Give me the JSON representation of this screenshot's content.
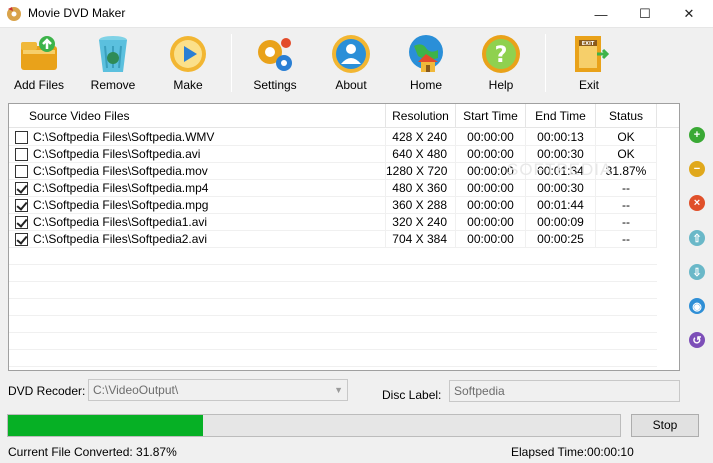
{
  "window": {
    "title": "Movie DVD Maker",
    "minimize": "—",
    "maximize": "☐",
    "close": "✕"
  },
  "toolbar": {
    "add_files": "Add Files",
    "remove": "Remove",
    "make": "Make",
    "settings": "Settings",
    "about": "About",
    "home": "Home",
    "help": "Help",
    "exit": "Exit",
    "exit_badge": "EXIT"
  },
  "list": {
    "headers": [
      "Source Video Files",
      "Resolution",
      "Start Time",
      "End Time",
      "Status"
    ],
    "rows": [
      {
        "checked": false,
        "file": "C:\\Softpedia Files\\Softpedia.WMV",
        "resolution": "428 X 240",
        "start": "00:00:00",
        "end": "00:00:13",
        "status": "OK"
      },
      {
        "checked": false,
        "file": "C:\\Softpedia Files\\Softpedia.avi",
        "resolution": "640 X 480",
        "start": "00:00:00",
        "end": "00:00:30",
        "status": "OK"
      },
      {
        "checked": false,
        "file": "C:\\Softpedia Files\\Softpedia.mov",
        "resolution": "1280 X 720",
        "start": "00:00:00",
        "end": "00:01:34",
        "status": "31.87%"
      },
      {
        "checked": true,
        "file": "C:\\Softpedia Files\\Softpedia.mp4",
        "resolution": "480 X 360",
        "start": "00:00:00",
        "end": "00:00:30",
        "status": "--"
      },
      {
        "checked": true,
        "file": "C:\\Softpedia Files\\Softpedia.mpg",
        "resolution": "360 X 288",
        "start": "00:00:00",
        "end": "00:01:44",
        "status": "--"
      },
      {
        "checked": true,
        "file": "C:\\Softpedia Files\\Softpedia1.avi",
        "resolution": "320 X 240",
        "start": "00:00:00",
        "end": "00:00:09",
        "status": "--"
      },
      {
        "checked": true,
        "file": "C:\\Softpedia Files\\Softpedia2.avi",
        "resolution": "704 X 384",
        "start": "00:00:00",
        "end": "00:00:25",
        "status": "--"
      }
    ],
    "watermark": "SOFTPEDIA"
  },
  "side_buttons": [
    {
      "name": "add",
      "glyph": "+",
      "color": "#3aa935"
    },
    {
      "name": "remove",
      "glyph": "−",
      "color": "#e0a81c"
    },
    {
      "name": "delete",
      "glyph": "×",
      "color": "#e0502a"
    },
    {
      "name": "move-up",
      "glyph": "⇧",
      "color": "#6ab8c8"
    },
    {
      "name": "move-down",
      "glyph": "⇩",
      "color": "#6ab8c8"
    },
    {
      "name": "settings",
      "glyph": "◉",
      "color": "#2f8fd6"
    },
    {
      "name": "refresh",
      "glyph": "↺",
      "color": "#7d4fb8"
    }
  ],
  "output": {
    "dvd_label": "DVD Recoder:",
    "dvd_path": "C:\\VideoOutput\\",
    "disc_label": "Disc Label:",
    "disc_value": "Softpedia"
  },
  "progress": {
    "fraction": 0.3187,
    "color": "#06b025"
  },
  "stop_label": "Stop",
  "status": {
    "converted": "Current File Converted: 31.87%",
    "elapsed": "Elapsed Time:00:00:10"
  }
}
